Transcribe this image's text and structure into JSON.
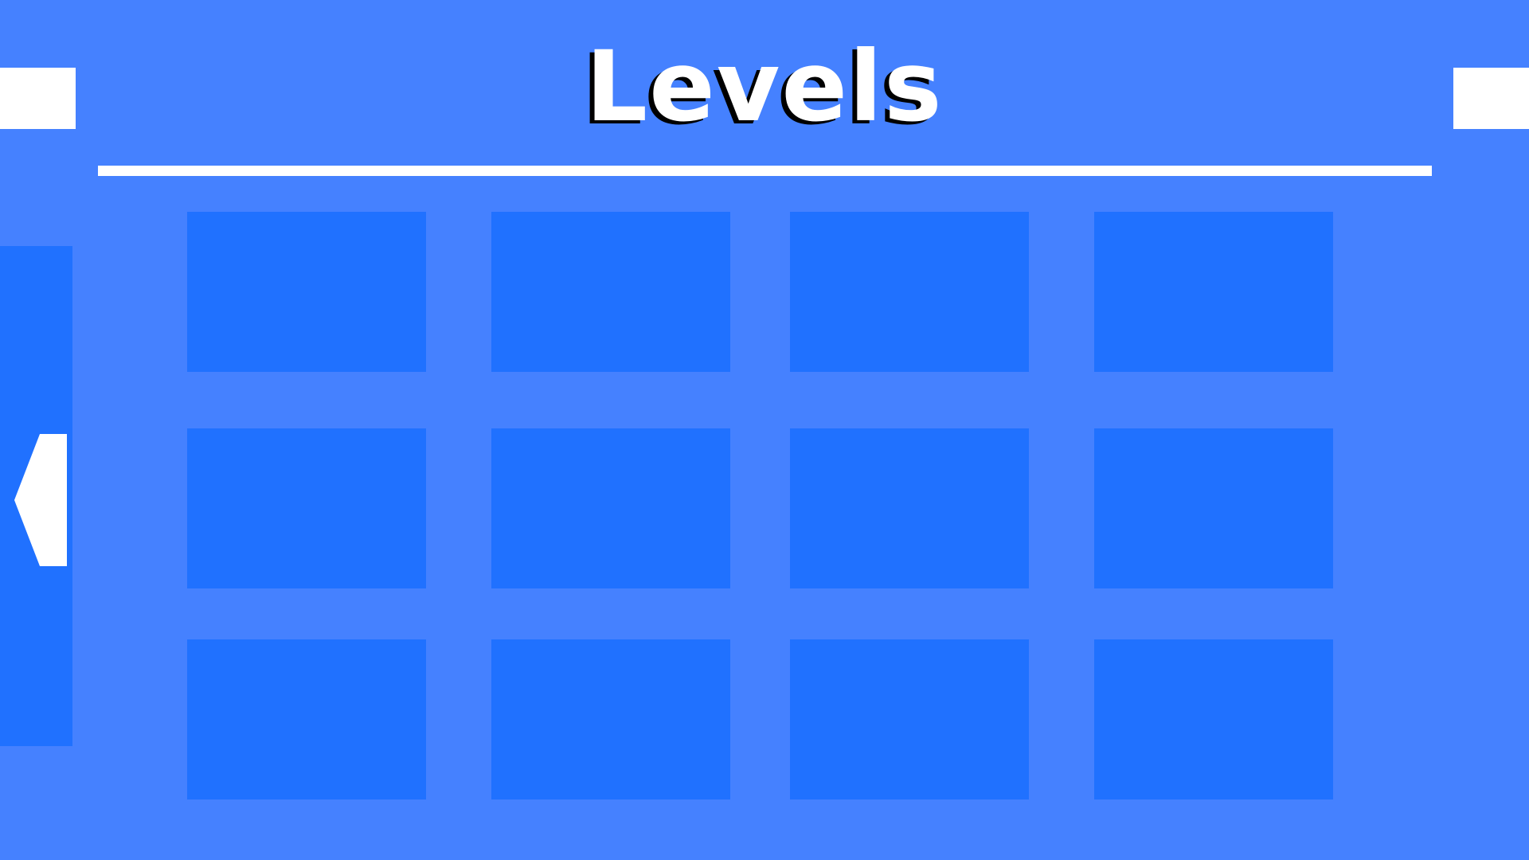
{
  "screen": {
    "title": "Levels"
  },
  "nav": {
    "back_icon": "chevron-left-icon"
  },
  "levels": {
    "rows": 3,
    "columns": 4,
    "slots": [
      {
        "row": 1,
        "col": 1
      },
      {
        "row": 1,
        "col": 2
      },
      {
        "row": 1,
        "col": 3
      },
      {
        "row": 1,
        "col": 4
      },
      {
        "row": 2,
        "col": 1
      },
      {
        "row": 2,
        "col": 2
      },
      {
        "row": 2,
        "col": 3
      },
      {
        "row": 2,
        "col": 4
      },
      {
        "row": 3,
        "col": 1
      },
      {
        "row": 3,
        "col": 2
      },
      {
        "row": 3,
        "col": 3
      },
      {
        "row": 3,
        "col": 4
      }
    ]
  },
  "colors": {
    "background": "#4581ff",
    "panel": "#2071ff",
    "accent": "#ffffff",
    "title_shadow": "#000000"
  }
}
